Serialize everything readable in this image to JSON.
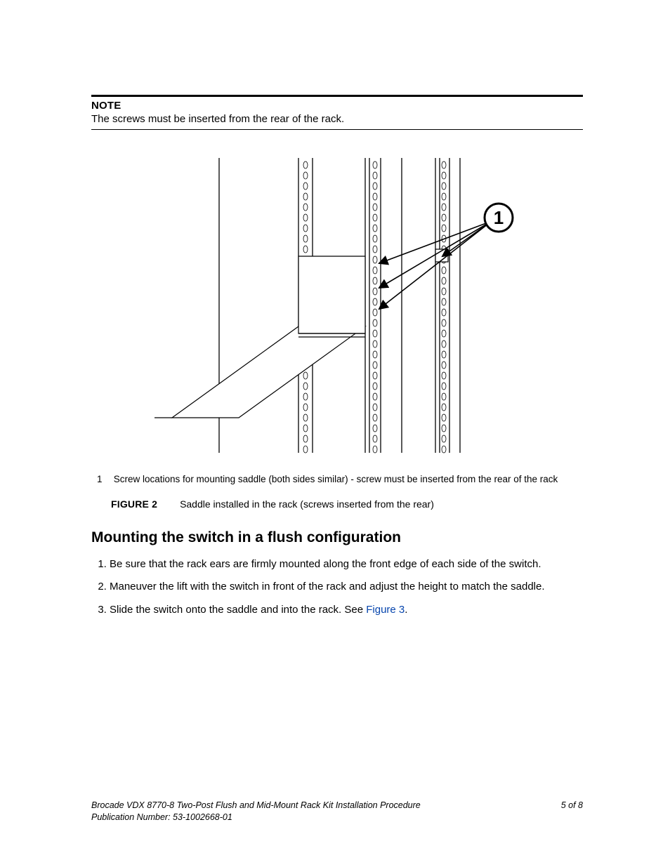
{
  "note": {
    "label": "NOTE",
    "body": "The screws must be inserted from the rear of the rack."
  },
  "figure": {
    "callout_number": "1",
    "legend_number": "1",
    "legend_text": "Screw locations for mounting saddle (both sides similar) - screw must be inserted from the rear of the rack",
    "label": "FIGURE 2",
    "caption": "Saddle installed in the rack (screws inserted from the rear)"
  },
  "section": {
    "heading": "Mounting the switch in a flush configuration",
    "steps": [
      "Be sure that the rack ears are firmly mounted along the front edge of each side of the switch.",
      "Maneuver the lift with the switch in front of the rack and adjust the height to match the saddle.",
      "Slide the switch onto the saddle and into the rack. See "
    ],
    "step3_link_text": "Figure 3",
    "step3_suffix": "."
  },
  "footer": {
    "title": "Brocade VDX 8770-8 Two-Post Flush and Mid-Mount Rack Kit Installation Procedure",
    "pub": "Publication Number: 53-1002668-01",
    "page": "5 of 8"
  }
}
